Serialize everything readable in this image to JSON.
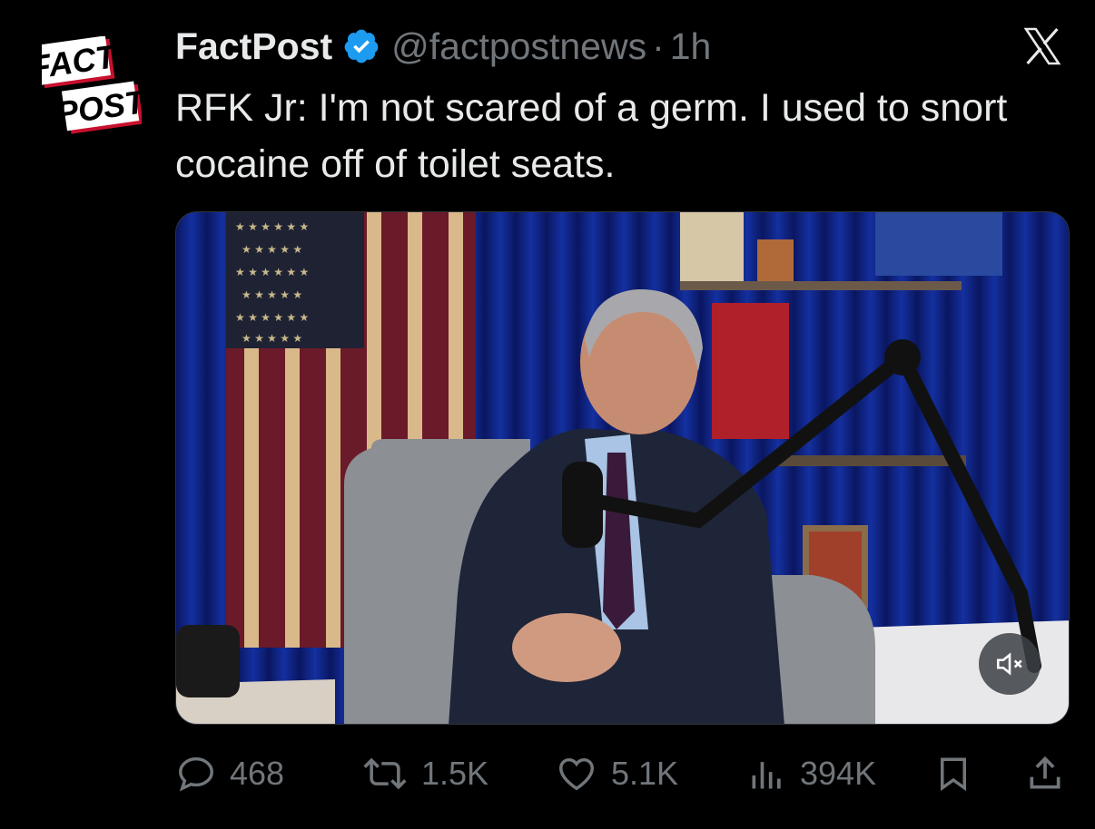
{
  "author": {
    "avatar_text_line1": "FACT",
    "avatar_text_line2": "POST",
    "name": "FactPost",
    "handle": "@factpostnews",
    "separator": "·",
    "time": "1h",
    "verified": true,
    "verified_color": "#1d9bf0"
  },
  "tweet": {
    "text": "RFK Jr: I'm not scared of a germ. I used to snort cocaine off of toilet seats."
  },
  "media": {
    "type": "video",
    "muted": true,
    "mute_icon": "speaker-muted-icon"
  },
  "actions": {
    "replies": "468",
    "reposts": "1.5K",
    "likes": "5.1K",
    "views": "394K"
  },
  "colors": {
    "background": "#000000",
    "text": "#e7e9ea",
    "secondary": "#71767b",
    "accent": "#1d9bf0"
  }
}
